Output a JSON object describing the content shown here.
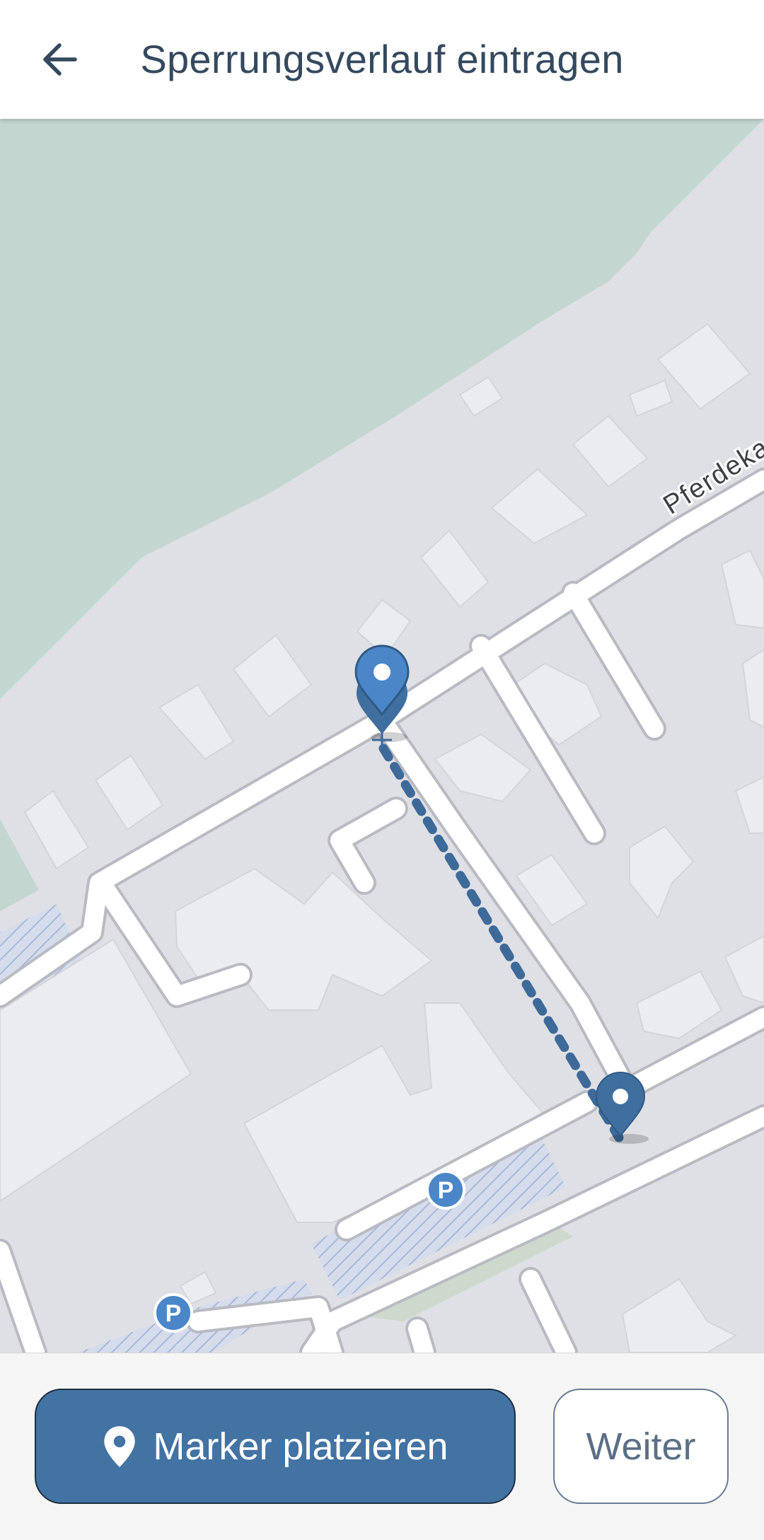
{
  "app_bar": {
    "title": "Sperrungsverlauf eintragen",
    "back_icon": "arrow-left-icon"
  },
  "map": {
    "street_label": "Pferdeka",
    "markers": [
      "start-marker",
      "end-marker",
      "dragging-marker"
    ],
    "parking_label": "P",
    "colors": {
      "background": "#dfe0e5",
      "park": "#c4d6d0",
      "road": "#ffffff",
      "building": "#ebecf0",
      "route": "#3e6a9a",
      "marker": "#4a86c8",
      "marker_dark": "#3f6f9f"
    }
  },
  "bottom_bar": {
    "place_marker_label": "Marker platzieren",
    "place_marker_icon": "location-pin-icon",
    "next_label": "Weiter"
  },
  "colors": {
    "primary": "#4273a3",
    "title_text": "#34495e",
    "outline": "#687c93"
  }
}
